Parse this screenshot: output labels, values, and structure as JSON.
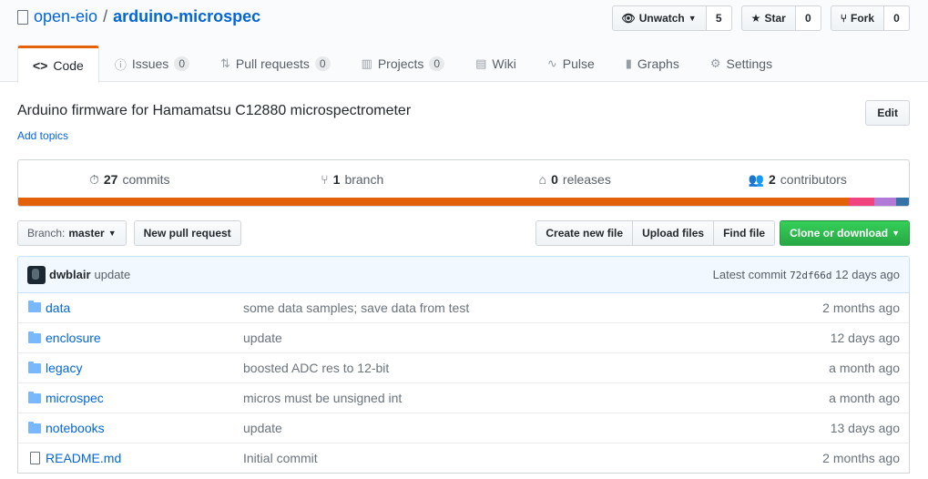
{
  "repo": {
    "owner": "open-eio",
    "separator": "/",
    "name": "arduino-microspec"
  },
  "actions": {
    "watch": {
      "label": "Unwatch",
      "count": "5"
    },
    "star": {
      "label": "Star",
      "count": "0"
    },
    "fork": {
      "label": "Fork",
      "count": "0"
    }
  },
  "tabs": [
    {
      "label": "Code",
      "icon": "code-icon"
    },
    {
      "label": "Issues",
      "icon": "issue-icon",
      "count": "0"
    },
    {
      "label": "Pull requests",
      "icon": "pull-request-icon",
      "count": "0"
    },
    {
      "label": "Projects",
      "icon": "project-icon",
      "count": "0"
    },
    {
      "label": "Wiki",
      "icon": "book-icon"
    },
    {
      "label": "Pulse",
      "icon": "pulse-icon"
    },
    {
      "label": "Graphs",
      "icon": "graph-icon"
    },
    {
      "label": "Settings",
      "icon": "gear-icon"
    }
  ],
  "description": "Arduino firmware for Hamamatsu C12880 microspectrometer",
  "add_topics": "Add topics",
  "edit_label": "Edit",
  "summary": {
    "commits": {
      "count": "27",
      "label": "commits"
    },
    "branches": {
      "count": "1",
      "label": "branch"
    },
    "releases": {
      "count": "0",
      "label": "releases"
    },
    "contributors": {
      "count": "2",
      "label": "contributors"
    }
  },
  "languages": [
    {
      "color": "#e36209",
      "share": 0.933
    },
    {
      "color": "#f1447e",
      "share": 0.028
    },
    {
      "color": "#b07ad6",
      "share": 0.025
    },
    {
      "color": "#3572a5",
      "share": 0.014
    }
  ],
  "branch": {
    "prefix": "Branch:",
    "name": "master"
  },
  "buttons": {
    "new_pr": "New pull request",
    "create_file": "Create new file",
    "upload": "Upload files",
    "find": "Find file",
    "clone": "Clone or download"
  },
  "latest_commit": {
    "author": "dwblair",
    "message": "update",
    "prefix": "Latest commit",
    "sha": "72df66d",
    "age": "12 days ago"
  },
  "files": [
    {
      "type": "dir",
      "name": "data",
      "message": "some data samples; save data from test",
      "age": "2 months ago"
    },
    {
      "type": "dir",
      "name": "enclosure",
      "message": "update",
      "age": "12 days ago"
    },
    {
      "type": "dir",
      "name": "legacy",
      "message": "boosted ADC res to 12-bit",
      "age": "a month ago"
    },
    {
      "type": "dir",
      "name": "microspec",
      "message": "micros must be unsigned int",
      "age": "a month ago"
    },
    {
      "type": "dir",
      "name": "notebooks",
      "message": "update",
      "age": "13 days ago"
    },
    {
      "type": "file",
      "name": "README.md",
      "message": "Initial commit",
      "age": "2 months ago"
    }
  ]
}
